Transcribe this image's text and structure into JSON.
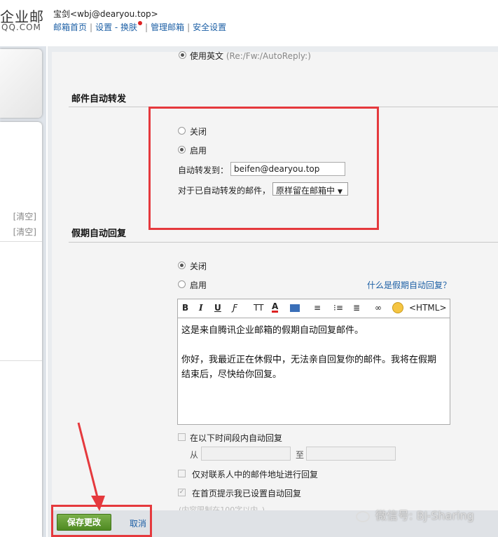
{
  "header": {
    "logo_text": "企业邮",
    "logo_sub": "QQ.COM",
    "user_name": "宝剑",
    "user_email": "<wbj@dearyou.top>",
    "links": [
      "邮箱首页",
      "设置 - 换肤",
      "管理邮箱",
      "安全设置"
    ]
  },
  "sidebar": {
    "clear_labels": [
      "[清空]",
      "[清空]"
    ]
  },
  "top_option": {
    "label": "使用英文",
    "hint": "(Re:/Fw:/AutoReply:)"
  },
  "forward": {
    "title": "邮件自动转发",
    "off_label": "关闭",
    "on_label": "启用",
    "selected": "启用",
    "to_label": "自动转发到：",
    "to_value": "beifen@dearyou.top",
    "handling_label": "对于已自动转发的邮件，",
    "handling_value": "原样留在邮箱中"
  },
  "vacation": {
    "title": "假期自动回复",
    "off_label": "关闭",
    "on_label": "启用",
    "selected": "关闭",
    "help_link": "什么是假期自动回复？",
    "toolbar": {
      "bold": "B",
      "italic": "I",
      "underline": "U",
      "font": "Ƒ",
      "size": "TT",
      "color": "A",
      "html": "<HTML>"
    },
    "body_line1": "这是来自腾讯企业邮箱的假期自动回复邮件。",
    "body_line2": "你好，我最近正在休假中，无法亲自回复你的邮件。我将在假期结束后，尽快给你回复。",
    "period_label": "在以下时间段内自动回复",
    "from_label": "从",
    "to_label": "至",
    "contacts_only_label": "仅对联系人中的邮件地址进行回复",
    "home_notice_label": "在首页提示我已设置自动回复",
    "length_hint": "(内容限制在100字以内。)"
  },
  "footer": {
    "save_label": "保存更改",
    "cancel_label": "取消"
  },
  "watermark": "微信号: BJ-Sharing",
  "colors": {
    "accent_red": "#e5393d",
    "link": "#1c5fa5",
    "save_green": "#5a9a2b"
  }
}
